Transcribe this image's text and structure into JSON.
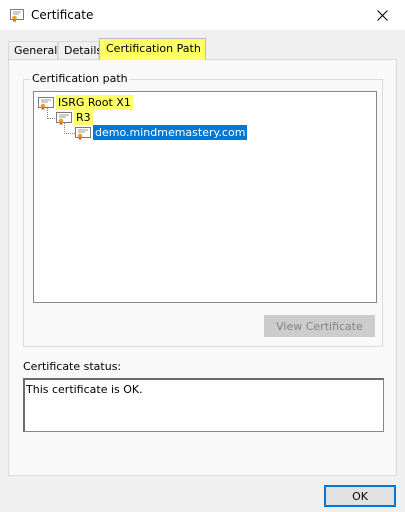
{
  "window": {
    "title": "Certificate",
    "close_icon": "close-icon"
  },
  "tabs": [
    {
      "label": "General"
    },
    {
      "label": "Details"
    },
    {
      "label": "Certification Path",
      "active": true
    }
  ],
  "certification_path": {
    "group_label": "Certification path",
    "nodes": [
      {
        "label": "ISRG Root X1",
        "level": 0,
        "highlight": "#ffff66"
      },
      {
        "label": "R3",
        "level": 1,
        "highlight": "#ffff66"
      },
      {
        "label": "demo.mindmemastery.com",
        "level": 2,
        "selected": true
      }
    ],
    "view_button_label": "View Certificate"
  },
  "status": {
    "label": "Certificate status:",
    "text": "This certificate is OK."
  },
  "ok_button_label": "OK",
  "colors": {
    "selection": "#0078d7",
    "highlight": "#ffff66"
  }
}
